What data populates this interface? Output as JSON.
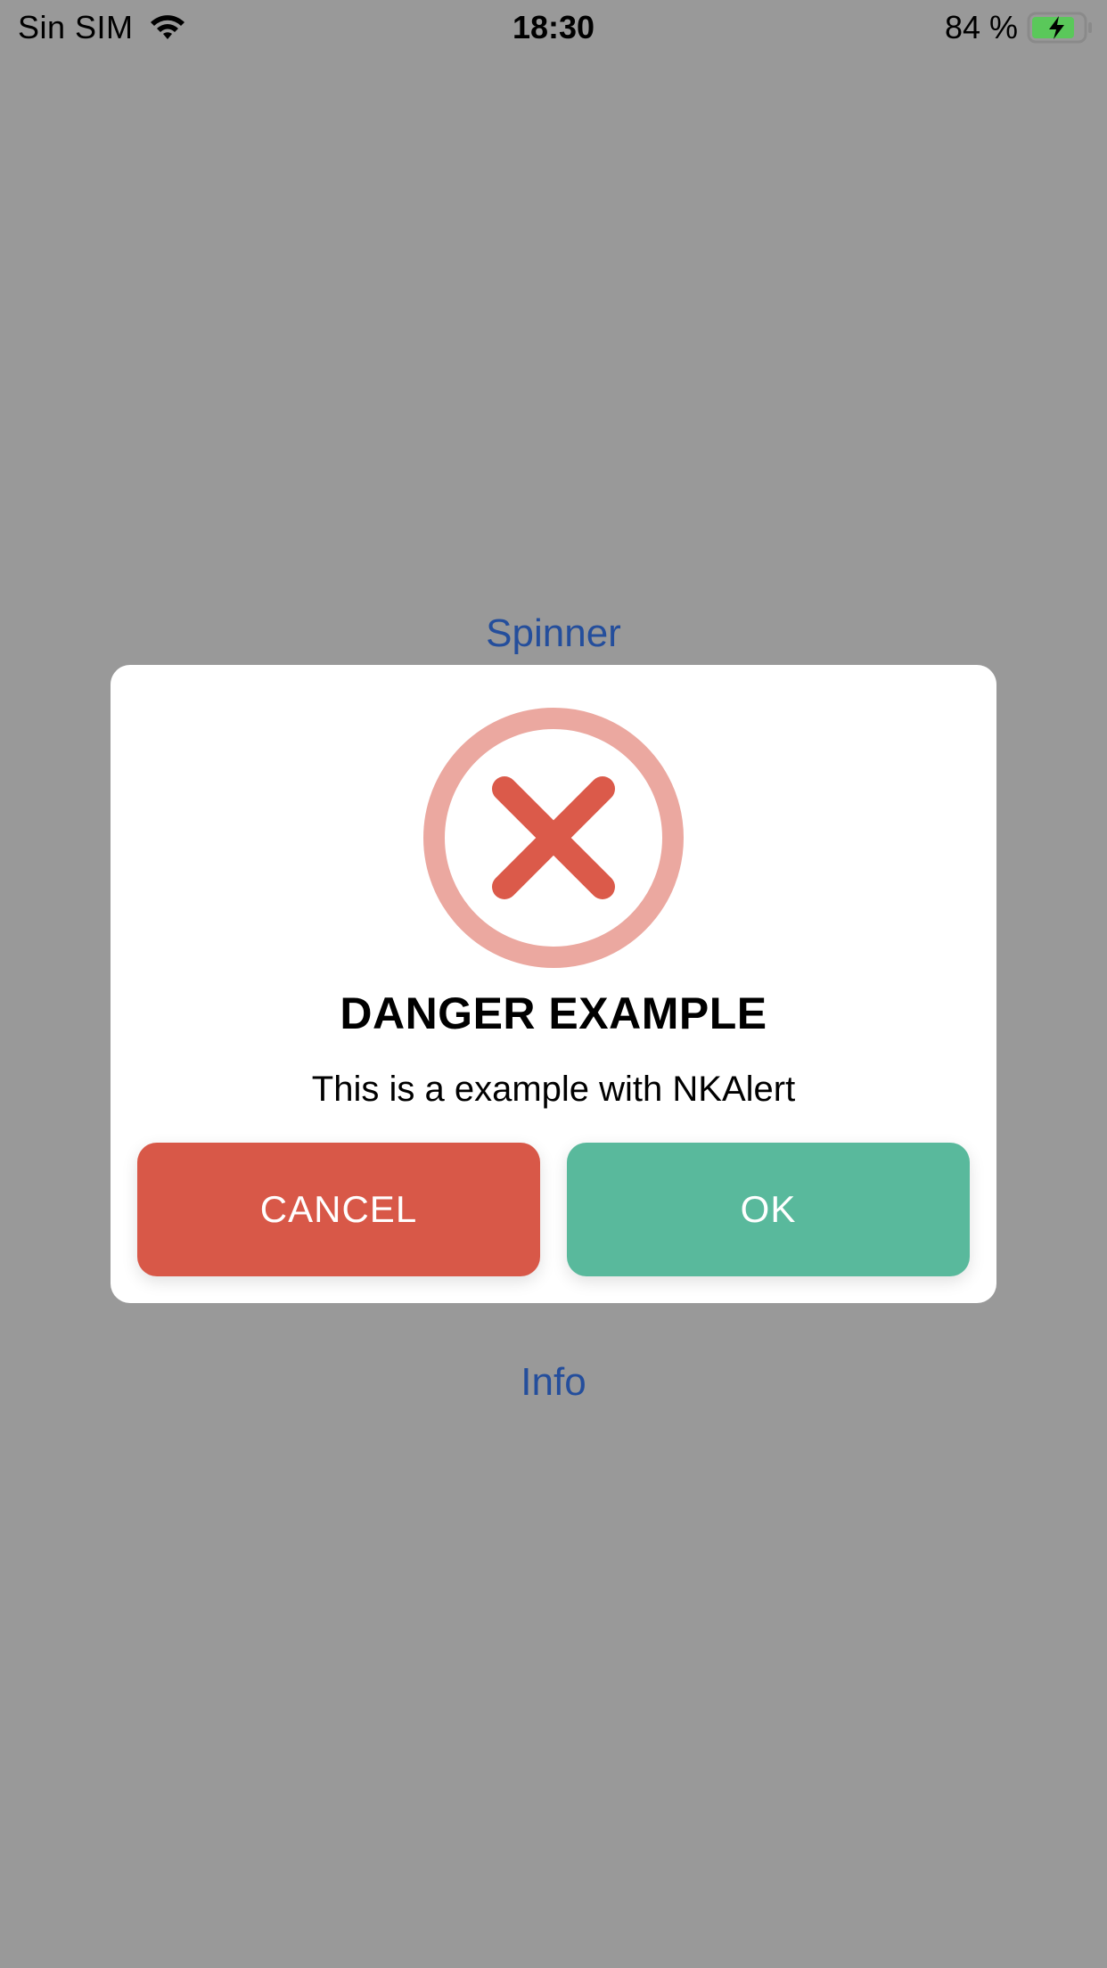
{
  "status_bar": {
    "carrier": "Sin SIM",
    "time": "18:30",
    "battery_percent": "84 %",
    "battery_level": 0.84,
    "wifi_icon": "wifi-icon",
    "battery_icon": "battery-charging-icon"
  },
  "background": {
    "color": "#999999",
    "links": {
      "spinner": "Spinner",
      "info": "Info"
    },
    "link_color": "#244e9c"
  },
  "alert": {
    "icon": "danger-x-circle-icon",
    "icon_ring_color": "#eba8a0",
    "icon_x_color": "#db5a4a",
    "title": "DANGER EXAMPLE",
    "message": "This is a example with NKAlert",
    "buttons": {
      "cancel": {
        "label": "CANCEL",
        "color": "#d85848"
      },
      "ok": {
        "label": "OK",
        "color": "#59b99c"
      }
    }
  }
}
